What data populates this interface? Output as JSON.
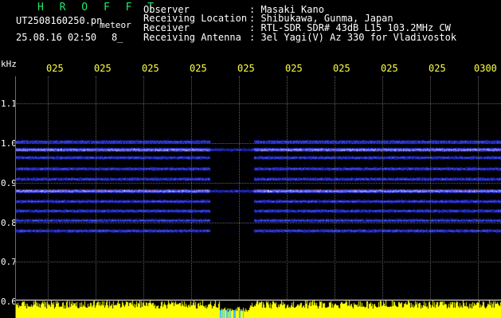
{
  "header": {
    "app_title": "H R O F F T",
    "file_name": "UT2508160250.pn",
    "file_tag": "meteor",
    "timestamp": "25.08.16 02:50",
    "extra": "8_"
  },
  "info": [
    {
      "key": "Observer",
      "value": ": Masaki Kano"
    },
    {
      "key": "Receiving Location",
      "value": ": Shibukawa, Gunma, Japan"
    },
    {
      "key": "Receiver",
      "value": ": RTL-SDR SDR# 43dB L15 103.2MHz CW"
    },
    {
      "key": "Receiving Antenna",
      "value": ": 3el Yagi(V) Az 330 for Vladivostok"
    }
  ],
  "axes": {
    "y_unit": "kHz",
    "x_ticks": [
      "025",
      "025",
      "025",
      "025",
      "025",
      "025",
      "025",
      "025",
      "025",
      "0300"
    ],
    "y_ticks": [
      "1.1",
      "1.0",
      "0.9",
      "0.8",
      "0.7",
      "0.6"
    ]
  },
  "colors": {
    "title": "#22e86a",
    "tick_x": "#ffff44",
    "trace": "#ffff00",
    "background": "#000000"
  },
  "waterfall": {
    "bands_khz": [
      1.005,
      0.985,
      0.965,
      0.935,
      0.91,
      0.88,
      0.855,
      0.83,
      0.805,
      0.78
    ],
    "strong_bands_khz": [
      0.985,
      0.88
    ],
    "gap_fraction": [
      0.4,
      0.49
    ]
  }
}
